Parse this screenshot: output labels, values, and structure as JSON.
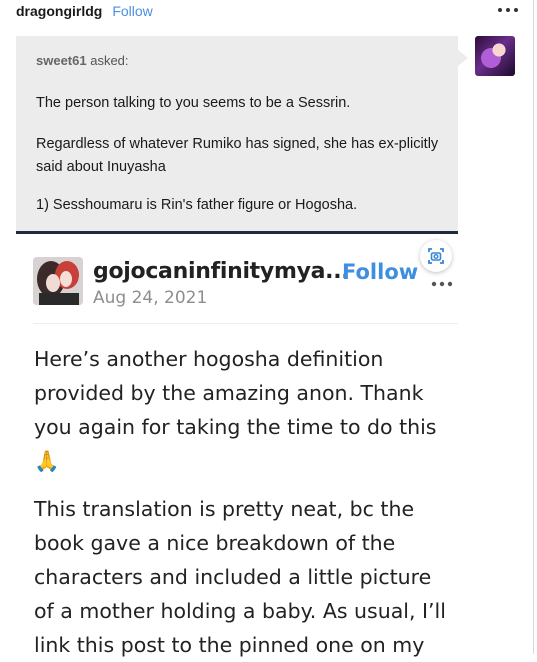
{
  "post": {
    "username": "dragongirldg",
    "follow_label": "Follow",
    "more_icon": "ellipsis-icon"
  },
  "ask": {
    "asker": "sweet61",
    "asked_suffix": "asked:",
    "paragraphs": [
      "The person talking to you seems to be a Sessrin.",
      "Regardless of whatever Rumiko has signed, she has ex-plicitly said about Inuyasha",
      "1) Sesshoumaru is Rin's father figure or Hogosha."
    ]
  },
  "embedded": {
    "username": "gojocaninfinitymya...",
    "date": "Aug 24, 2021",
    "follow_label": "Follow",
    "paragraphs": [
      "Here’s another hogosha definition provided by  the amazing anon. Thank you again for taking the time to do this 🙏",
      "This translation is pretty neat, bc the book gave a nice breakdown of the characters and included a little picture of a mother holding a baby. As usual, I’ll link this post to the pinned one on my"
    ]
  },
  "colors": {
    "follow_blue": "#4a90e2",
    "ask_background": "#ececec",
    "ask_border": "#1f2a3a"
  }
}
